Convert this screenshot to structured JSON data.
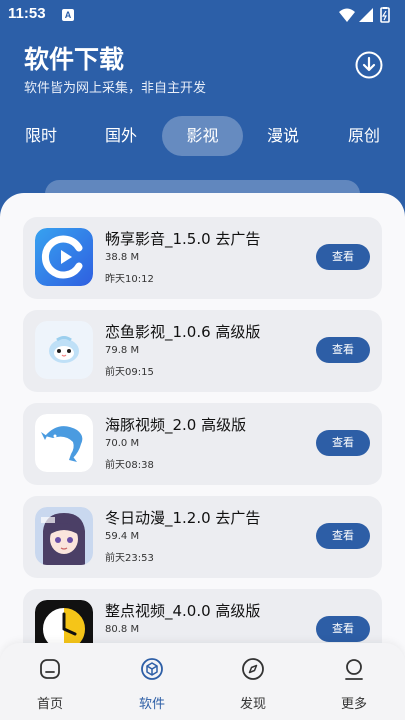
{
  "status_bar": {
    "time": "11:53",
    "notification_badge": "A"
  },
  "header": {
    "title": "软件下载",
    "subtitle": "软件皆为网上采集，非自主开发",
    "download_icon": "download-circle-icon"
  },
  "tabs": [
    {
      "label": "限时",
      "active": false
    },
    {
      "label": "国外",
      "active": false
    },
    {
      "label": "影视",
      "active": true
    },
    {
      "label": "漫说",
      "active": false
    },
    {
      "label": "原创",
      "active": false
    }
  ],
  "apps": [
    {
      "name": "畅享影音_1.5.0 去广告",
      "size": "38.8 M",
      "time": "昨天10:12",
      "button": "查看",
      "icon": "play-circle-app-icon"
    },
    {
      "name": "恋鱼影视_1.0.6 高级版",
      "size": "79.8 M",
      "time": "前天09:15",
      "button": "查看",
      "icon": "fish-mascot-app-icon"
    },
    {
      "name": "海豚视频_2.0 高级版",
      "size": "70.0 M",
      "time": "前天08:38",
      "button": "查看",
      "icon": "dolphin-app-icon"
    },
    {
      "name": "冬日动漫_1.2.0 去广告",
      "size": "59.4 M",
      "time": "前天23:53",
      "button": "查看",
      "icon": "anime-girl-app-icon"
    },
    {
      "name": "整点视频_4.0.0 高级版",
      "size": "80.8 M",
      "time": "",
      "button": "查看",
      "icon": "clock-app-icon"
    }
  ],
  "bottom_nav": [
    {
      "label": "首页",
      "icon": "home-icon",
      "active": false
    },
    {
      "label": "软件",
      "icon": "cube-icon",
      "active": true
    },
    {
      "label": "发现",
      "icon": "compass-icon",
      "active": false
    },
    {
      "label": "更多",
      "icon": "person-icon",
      "active": false
    }
  ],
  "colors": {
    "primary": "#2c5fa8",
    "button": "#2d5ea6",
    "card": "#ecedf1",
    "sheet": "#f9f9fb"
  }
}
